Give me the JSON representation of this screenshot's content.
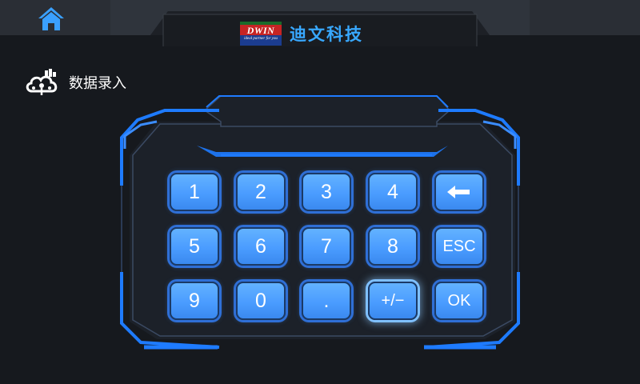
{
  "header": {
    "home_icon": "home-icon",
    "logo_text": "DWIN",
    "logo_tagline": "ideal partner for you",
    "company_name": "迪文科技"
  },
  "page": {
    "title_icon": "cloud-data-icon",
    "title": "数据录入"
  },
  "keypad": {
    "display_value": "",
    "keys": [
      {
        "label": "1"
      },
      {
        "label": "2"
      },
      {
        "label": "3"
      },
      {
        "label": "4"
      },
      {
        "label": "←",
        "icon": "backspace-arrow-icon"
      },
      {
        "label": "5"
      },
      {
        "label": "6"
      },
      {
        "label": "7"
      },
      {
        "label": "8"
      },
      {
        "label": "ESC"
      },
      {
        "label": "9"
      },
      {
        "label": "0"
      },
      {
        "label": "."
      },
      {
        "label": "+/−"
      },
      {
        "label": "OK"
      }
    ]
  },
  "colors": {
    "background": "#16191e",
    "accent": "#1e7bff",
    "key": "#4a9cff",
    "brand_text": "#38a8ff"
  }
}
